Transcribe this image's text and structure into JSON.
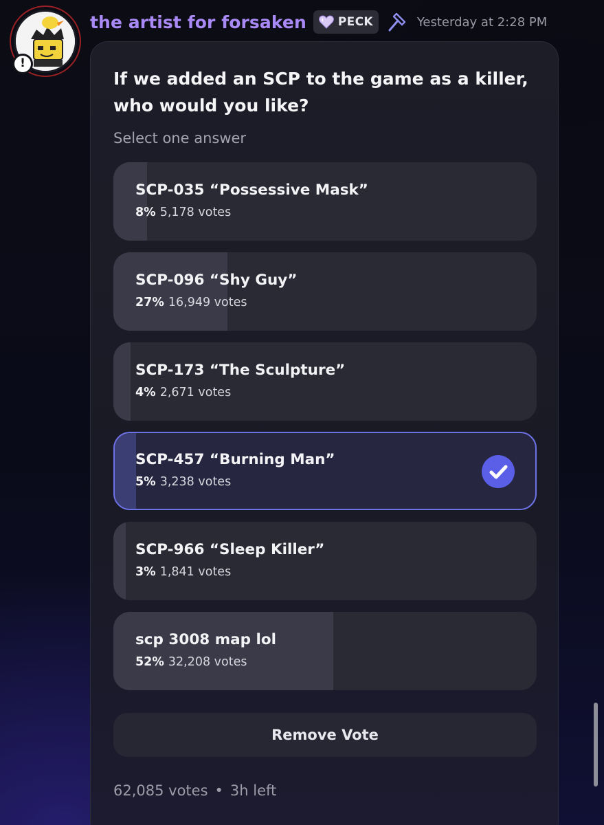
{
  "message": {
    "username": "the artist for forsaken",
    "tag": {
      "label": "PECK",
      "icon": "heart-icon"
    },
    "role_icon": "hammer-icon",
    "timestamp": "Yesterday at 2:28 PM",
    "avatar_status": "!"
  },
  "poll": {
    "question": "If we added an SCP to the game as a killer, who would you like?",
    "subtitle": "Select one answer",
    "options": [
      {
        "label": "SCP-035 “Possessive Mask”",
        "percent_text": "8%",
        "votes_text": "5,178 votes",
        "fill_fraction": 0.08,
        "selected": false
      },
      {
        "label": "SCP-096 “Shy Guy”",
        "percent_text": "27%",
        "votes_text": "16,949 votes",
        "fill_fraction": 0.27,
        "selected": false
      },
      {
        "label": "SCP-173 “The Sculpture”",
        "percent_text": "4%",
        "votes_text": "2,671 votes",
        "fill_fraction": 0.04,
        "selected": false
      },
      {
        "label": "SCP-457 “Burning Man”",
        "percent_text": "5%",
        "votes_text": "3,238 votes",
        "fill_fraction": 0.05,
        "selected": true
      },
      {
        "label": "SCP-966 “Sleep Killer”",
        "percent_text": "3%",
        "votes_text": "1,841 votes",
        "fill_fraction": 0.03,
        "selected": false
      },
      {
        "label": "scp 3008 map lol",
        "percent_text": "52%",
        "votes_text": "32,208 votes",
        "fill_fraction": 0.52,
        "selected": false
      }
    ],
    "remove_vote_label": "Remove Vote",
    "footer": {
      "total_votes": "62,085 votes",
      "separator": "•",
      "time_left": "3h left"
    }
  },
  "colors": {
    "username": "#a989f5",
    "accent": "#5b5fe8",
    "selected_border": "#6d71e6"
  }
}
